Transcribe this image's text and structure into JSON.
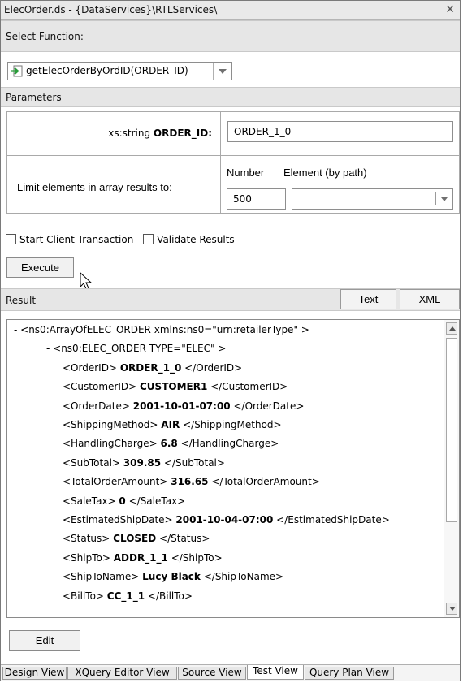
{
  "window": {
    "title": "ElecOrder.ds - {DataServices}\\RTLServices\\"
  },
  "select_function": {
    "section_label": "Select Function:",
    "selected": "getElecOrderByOrdID(ORDER_ID)"
  },
  "parameters": {
    "section_label": "Parameters",
    "order_id_type": "xs:string",
    "order_id_name": "ORDER_ID:",
    "order_id_value": "ORDER_1_0",
    "limit_label": "Limit elements in array results to:",
    "number_label": "Number",
    "element_label": "Element (by path)",
    "number_value": "500",
    "element_value": ""
  },
  "options": {
    "start_transaction": "Start Client Transaction",
    "validate_results": "Validate Results"
  },
  "execute_label": "Execute",
  "result": {
    "section_label": "Result",
    "text_tab": "Text",
    "xml_tab": "XML",
    "lines": [
      {
        "pre": "- <ns0:ArrayOfELEC_ORDER xmlns:ns0=\"urn:retailerType\" >",
        "val": "",
        "post": ""
      },
      {
        "pre": "- <ns0:ELEC_ORDER TYPE=\"ELEC\" >",
        "val": "",
        "post": ""
      },
      {
        "pre": "<OrderID> ",
        "val": "ORDER_1_0",
        "post": " </OrderID>"
      },
      {
        "pre": "<CustomerID> ",
        "val": "CUSTOMER1",
        "post": " </CustomerID>"
      },
      {
        "pre": "<OrderDate> ",
        "val": "2001-10-01-07:00",
        "post": " </OrderDate>"
      },
      {
        "pre": "<ShippingMethod> ",
        "val": "AIR",
        "post": " </ShippingMethod>"
      },
      {
        "pre": "<HandlingCharge> ",
        "val": "6.8",
        "post": " </HandlingCharge>"
      },
      {
        "pre": "<SubTotal> ",
        "val": "309.85",
        "post": " </SubTotal>"
      },
      {
        "pre": "<TotalOrderAmount> ",
        "val": "316.65",
        "post": " </TotalOrderAmount>"
      },
      {
        "pre": "<SaleTax> ",
        "val": "0",
        "post": " </SaleTax>"
      },
      {
        "pre": "<EstimatedShipDate> ",
        "val": "2001-10-04-07:00",
        "post": " </EstimatedShipDate>"
      },
      {
        "pre": "<Status> ",
        "val": "CLOSED",
        "post": " </Status>"
      },
      {
        "pre": "<ShipTo> ",
        "val": "ADDR_1_1",
        "post": " </ShipTo>"
      },
      {
        "pre": "<ShipToName> ",
        "val": "Lucy Black",
        "post": " </ShipToName>"
      },
      {
        "pre": "<BillTo> ",
        "val": "CC_1_1",
        "post": " </BillTo>"
      }
    ]
  },
  "edit_label": "Edit",
  "view_tabs": [
    {
      "label": "Design View"
    },
    {
      "label": "XQuery Editor View"
    },
    {
      "label": "Source View"
    },
    {
      "label": "Test View",
      "active": true
    },
    {
      "label": "Query Plan View"
    }
  ],
  "colors": {
    "function_icon": "#2a9d3a",
    "section_bg": "#e6e6e6"
  }
}
